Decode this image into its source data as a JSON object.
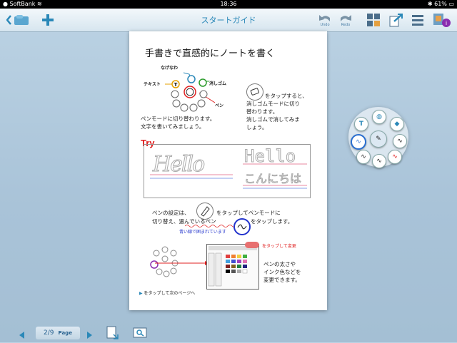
{
  "status_bar": {
    "carrier": "SoftBank",
    "time": "18:36",
    "battery": "61%"
  },
  "toolbar": {
    "title": "スタートガイド",
    "undo_label": "Undo",
    "redo_label": "Redo"
  },
  "guide_page": {
    "heading": "手書きで直感的にノートを書く",
    "label_nagenawa": "なげなわ",
    "label_text": "テキスト",
    "label_eraser": "消しゴム",
    "label_pen": "ペン",
    "eraser_desc": [
      "をタップすると、",
      "消しゴムモードに切り",
      "替わります。",
      "消しゴムで消してみま",
      "しょう。"
    ],
    "pen_desc": [
      "ペンモードに切り替わります。",
      "文字を書いてみましょう。"
    ],
    "try_label": "Try",
    "trace_hello_script": "Hello",
    "trace_hello": "Hello",
    "trace_konnichiwa": "こんにちは",
    "pen_settings_line1a": "ペンの設定は、",
    "pen_settings_line1b": "をタップしてペンモードに",
    "pen_settings_line2": "切り替え、選んでいるペン",
    "pen_settings_line2b": "をタップします。",
    "blue_circle_note": "青い線で囲まれています",
    "tap_change_note": "をタップして変更",
    "thickness_desc": [
      "ペンの太さや",
      "インク色などを",
      "変更できます。"
    ],
    "next_page_note": "をタップして次のページへ"
  },
  "bottom_bar": {
    "page_number": "2/9",
    "page_label": "Page"
  },
  "colors": {
    "accent": "#2a88b8",
    "try_red": "#e02020",
    "annotation_blue": "#2233cc"
  }
}
